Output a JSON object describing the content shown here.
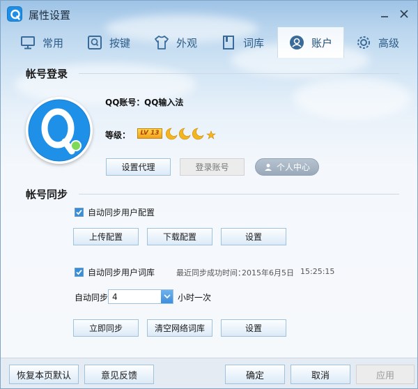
{
  "window": {
    "title": "属性设置"
  },
  "tabs": [
    {
      "label": "常用",
      "icon": "monitor-icon"
    },
    {
      "label": "按键",
      "icon": "key-icon"
    },
    {
      "label": "外观",
      "icon": "shirt-icon"
    },
    {
      "label": "词库",
      "icon": "book-icon"
    },
    {
      "label": "账户",
      "icon": "user-icon",
      "active": true
    },
    {
      "label": "高级",
      "icon": "gear-icon"
    }
  ],
  "account_login": {
    "heading": "帐号登录",
    "qq_account_label": "QQ账号：",
    "qq_account_value": "QQ输入法",
    "level_label": "等级：",
    "level_badge": "LV 13",
    "buttons": {
      "proxy": "设置代理",
      "login": "登录账号",
      "personal_center": "个人中心"
    }
  },
  "account_sync": {
    "heading": "帐号同步",
    "sync_config_label": "自动同步用户配置",
    "sync_config_checked": true,
    "config_buttons": {
      "upload": "上传配置",
      "download": "下载配置",
      "settings": "设置"
    },
    "sync_dict_label": "自动同步用户词库",
    "sync_dict_checked": true,
    "last_sync_label": "最近同步成功时间：",
    "last_sync_date": "2015年6月5日",
    "last_sync_time": "15:25:15",
    "auto_sync_label": "自动同步",
    "auto_sync_value": "4",
    "auto_sync_unit": "小时一次",
    "dict_buttons": {
      "sync_now": "立即同步",
      "clear_network_dict": "清空网络词库",
      "settings": "设置"
    }
  },
  "footer": {
    "restore_default": "恢复本页默认",
    "feedback": "意见反馈",
    "ok": "确定",
    "cancel": "取消",
    "apply": "应用"
  },
  "colors": {
    "accent": "#1f8fe6",
    "tab_text": "#2d5c88",
    "level_badge": "#f0a21a",
    "online_dot": "#7ed957"
  }
}
